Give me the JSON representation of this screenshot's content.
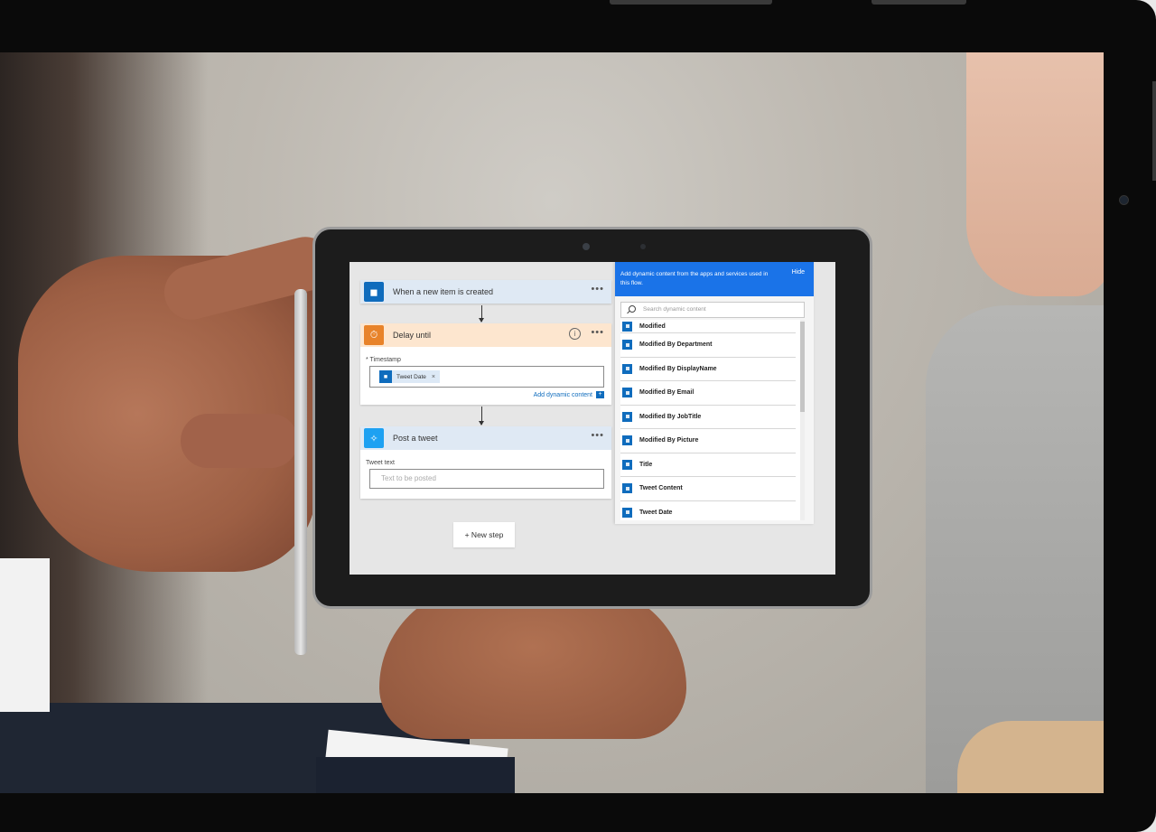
{
  "flow": {
    "trigger": {
      "title": "When a new item is created",
      "menu": "•••",
      "color": "#0f6cbd"
    },
    "delay": {
      "title": "Delay until",
      "menu": "•••",
      "info": "i",
      "color": "#e8832a",
      "field_label": "* Timestamp",
      "token": {
        "label": "Tweet Date",
        "remove": "×"
      },
      "add_dynamic": "Add dynamic content",
      "add_dynamic_plus": "+"
    },
    "tweet": {
      "title": "Post a tweet",
      "menu": "•••",
      "color": "#1da1f2",
      "field_label": "Tweet text",
      "placeholder": "Text to be posted"
    },
    "new_step": "+ New step"
  },
  "dynamic_panel": {
    "header": "Add dynamic content from the apps and services used in this flow.",
    "hide": "Hide",
    "search_placeholder": "Search dynamic content",
    "items": [
      "Modified",
      "Modified By Department",
      "Modified By DisplayName",
      "Modified By Email",
      "Modified By JobTitle",
      "Modified By Picture",
      "Title",
      "Tweet Content",
      "Tweet Date"
    ]
  },
  "colors": {
    "accent_blue": "#1a73e8",
    "token_blue": "#0f6cbd"
  }
}
